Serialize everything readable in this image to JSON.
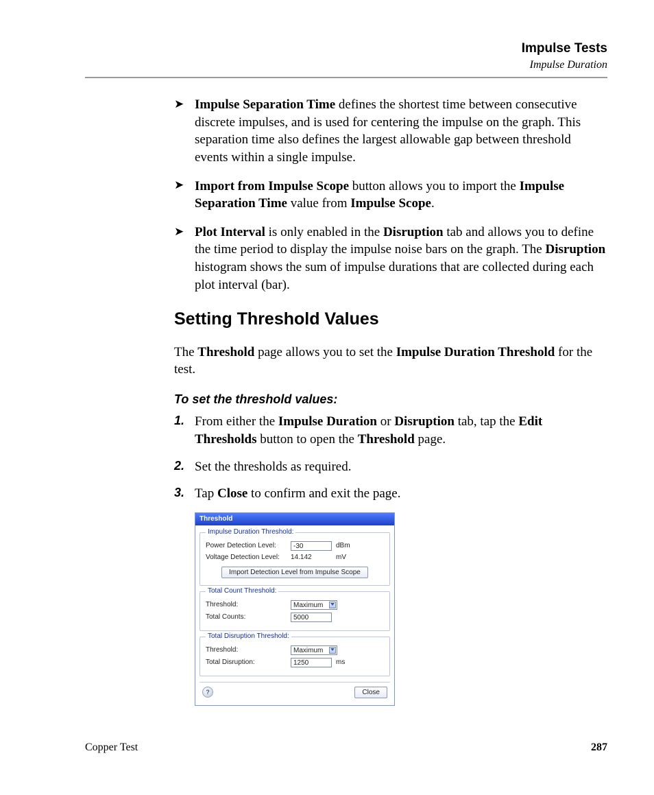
{
  "running_head": {
    "chapter": "Impulse Tests",
    "section": "Impulse Duration"
  },
  "bullets": {
    "b1_strong": "Impulse Separation Time",
    "b1_rest": " defines the shortest time between consecutive discrete impulses, and is used for centering the impulse on the graph. This separation time also defines the largest allowable gap between threshold events within a single impulse.",
    "b2_s1": "Import from Impulse Scope",
    "b2_t1": " button allows you to import the ",
    "b2_s2": "Impulse Separation Time",
    "b2_t2": " value from ",
    "b2_s3": "Impulse Scope",
    "b2_t3": ".",
    "b3_s1": "Plot Interval",
    "b3_t1": " is only enabled in the ",
    "b3_s2": "Disruption",
    "b3_t2": " tab and allows you to define the time period to display the impulse noise bars on the graph. The ",
    "b3_s3": "Disruption",
    "b3_t3": " histogram shows the sum of impulse durations that are collected during each plot interval (bar)."
  },
  "heading2": "Setting Threshold Values",
  "para1": {
    "t1": "The ",
    "s1": "Threshold",
    "t2": " page allows you to set the ",
    "s2": "Impulse Duration Threshold",
    "t3": " for the test."
  },
  "lead": "To set the threshold values:",
  "steps": {
    "s1": {
      "t1": "From either the ",
      "b1": "Impulse Duration",
      "t2": " or ",
      "b2": "Disruption",
      "t3": " tab, tap the ",
      "b3": "Edit Thresholds",
      "t4": " button to open the ",
      "b4": "Threshold",
      "t5": " page."
    },
    "s2": {
      "t1": "Set the thresholds as required."
    },
    "s3": {
      "t1": "Tap ",
      "b1": "Close",
      "t2": " to confirm and exit the page."
    }
  },
  "dialog": {
    "title": "Threshold",
    "fs1": {
      "legend": "Impulse Duration Threshold:",
      "row1_label": "Power Detection Level:",
      "row1_value": "-30",
      "row1_unit": "dBm",
      "row2_label": "Voltage Detection Level:",
      "row2_value": "14.142",
      "row2_unit": "mV",
      "import_btn": "Import Detection Level from Impulse Scope"
    },
    "fs2": {
      "legend": "Total Count Threshold:",
      "row1_label": "Threshold:",
      "row1_value": "Maximum",
      "row2_label": "Total Counts:",
      "row2_value": "5000"
    },
    "fs3": {
      "legend": "Total Disruption Threshold:",
      "row1_label": "Threshold:",
      "row1_value": "Maximum",
      "row2_label": "Total Disruption:",
      "row2_value": "1250",
      "row2_unit": "ms"
    },
    "close_btn": "Close"
  },
  "footer": {
    "left": "Copper Test",
    "page": "287"
  }
}
